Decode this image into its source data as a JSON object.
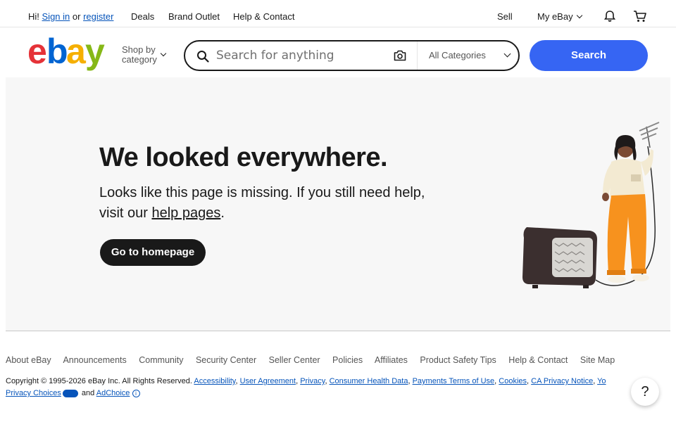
{
  "topbar": {
    "greeting_prefix": "Hi!",
    "sign_in": "Sign in",
    "or": "or",
    "register": "register",
    "deals": "Deals",
    "brand_outlet": "Brand Outlet",
    "help_contact": "Help & Contact",
    "sell": "Sell",
    "my_ebay": "My eBay"
  },
  "header": {
    "shop_by_line1": "Shop by",
    "shop_by_line2": "category",
    "search_placeholder": "Search for anything",
    "category": "All Categories",
    "search_button": "Search"
  },
  "hero": {
    "title": "We looked everywhere.",
    "message_part1": "Looks like this page is missing. If you still need help, visit our ",
    "message_link": "help pages",
    "message_end": ".",
    "home_button": "Go to homepage"
  },
  "footer": {
    "links": [
      "About eBay",
      "Announcements",
      "Community",
      "Security Center",
      "Seller Center",
      "Policies",
      "Affiliates",
      "Product Safety Tips",
      "Help & Contact",
      "Site Map"
    ],
    "copyright": "Copyright © 1995-2026 eBay Inc. All Rights Reserved.",
    "legal_links": [
      "Accessibility",
      "User Agreement",
      "Privacy",
      "Consumer Health Data",
      "Payments Terms of Use",
      "Cookies",
      "CA Privacy Notice",
      "Yo"
    ],
    "privacy_choices": "Privacy Choices",
    "and": "and",
    "adchoice": "AdChoice",
    "help_fab": "?"
  },
  "colors": {
    "brand_blue": "#3665f3",
    "link_blue": "#0654ba",
    "logo_red": "#e53238",
    "logo_blue": "#0064d2",
    "logo_yellow": "#f5af02",
    "logo_green": "#86b817",
    "pants_orange": "#f7921e"
  },
  "icons": [
    "search-icon",
    "camera-icon",
    "bell-icon",
    "cart-icon",
    "chevron-down-icon",
    "help-icon"
  ]
}
